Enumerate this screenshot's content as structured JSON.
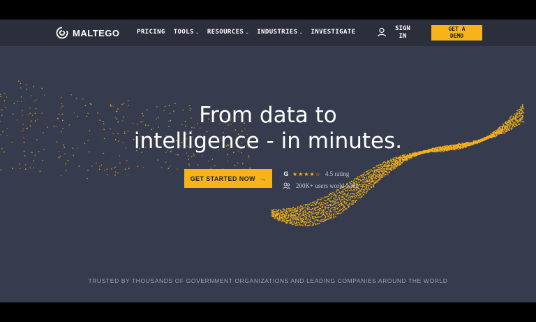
{
  "nav": {
    "logo_text": "MALTEGO",
    "items": [
      {
        "label": "PRICING",
        "has_caret": false
      },
      {
        "label": "TOOLS",
        "has_caret": true
      },
      {
        "label": "RESOURCES",
        "has_caret": true
      },
      {
        "label": "INDUSTRIES",
        "has_caret": true
      },
      {
        "label": "INVESTIGATE",
        "has_caret": false
      }
    ],
    "sign_in": [
      "SIGN",
      "IN"
    ],
    "demo": [
      "GET A",
      "DEMO"
    ],
    "caret_glyph": "⌄"
  },
  "hero": {
    "line1": "From data to",
    "line2": "intelligence - in minutes.",
    "cta_label": "GET STARTED NOW",
    "cta_arrow": "→",
    "rating_stars": "★★★★☆",
    "rating_value": 4.5,
    "rating_text": "4.5 rating",
    "users_text": "200K+ users world-wide"
  },
  "trusted_text": "TRUSTED BY THOUSANDS OF GOVERNMENT ORGANIZATIONS AND LEADING COMPANIES AROUND THE WORLD",
  "colors": {
    "accent": "#f7b31a",
    "nav_bg": "#2a2f3b",
    "page_bg": "#363c4d"
  },
  "icons": [
    "maltego-logo-icon",
    "caret-down-icon",
    "user-icon",
    "arrow-right-icon",
    "google-icon",
    "star-icon",
    "users-icon"
  ]
}
